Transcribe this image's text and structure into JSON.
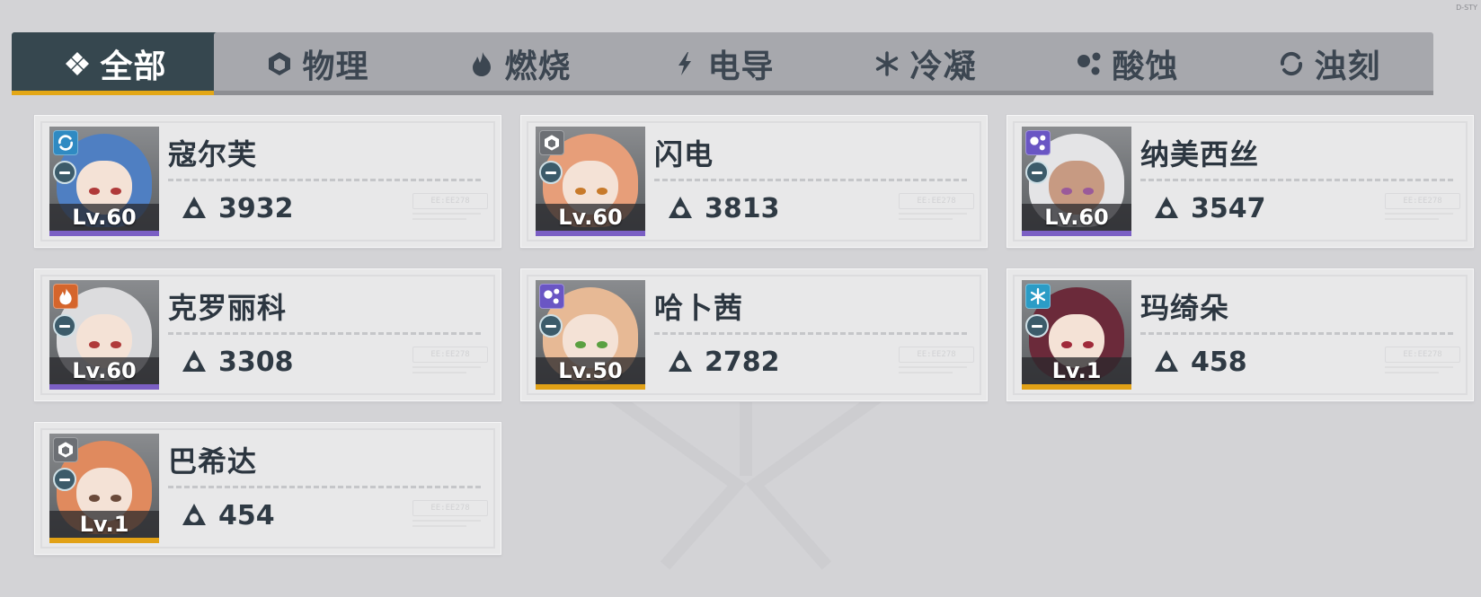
{
  "corner_code": "D-STY",
  "tabs": [
    {
      "label": "全部",
      "icon": "diamond-cluster-icon",
      "active": true
    },
    {
      "label": "物理",
      "icon": "hexagon-icon",
      "active": false
    },
    {
      "label": "燃烧",
      "icon": "flame-icon",
      "active": false
    },
    {
      "label": "电导",
      "icon": "lightning-icon",
      "active": false
    },
    {
      "label": "冷凝",
      "icon": "snowflake-icon",
      "active": false
    },
    {
      "label": "酸蚀",
      "icon": "acid-dots-icon",
      "active": false
    },
    {
      "label": "浊刻",
      "icon": "swirl-icon",
      "active": false
    }
  ],
  "colors": {
    "active_tab_bg": "#36474f",
    "active_tab_underline": "#e3a716",
    "rarity_purple": "#7b5fc4",
    "rarity_gold": "#e1a116",
    "elem_physical": "#6c6f74",
    "elem_burn": "#d5652c",
    "elem_electric": "#5b6fb5",
    "elem_freeze": "#2b9cc6",
    "elem_acid": "#6a56c4",
    "elem_turbid": "#2f8ac2"
  },
  "characters": [
    {
      "name": "寇尔芙",
      "level": "Lv.60",
      "power": "3932",
      "element": "swirl-icon",
      "rarity": "purple"
    },
    {
      "name": "闪电",
      "level": "Lv.60",
      "power": "3813",
      "element": "hexagon-icon",
      "rarity": "purple"
    },
    {
      "name": "纳美西丝",
      "level": "Lv.60",
      "power": "3547",
      "element": "acid-dots-icon",
      "rarity": "purple"
    },
    {
      "name": "克罗丽科",
      "level": "Lv.60",
      "power": "3308",
      "element": "flame-icon",
      "rarity": "purple"
    },
    {
      "name": "哈卜茜",
      "level": "Lv.50",
      "power": "2782",
      "element": "acid-dots-icon",
      "rarity": "gold"
    },
    {
      "name": "玛绮朵",
      "level": "Lv.1",
      "power": "458",
      "element": "snowflake-icon",
      "rarity": "gold"
    },
    {
      "name": "巴希达",
      "level": "Lv.1",
      "power": "454",
      "element": "hexagon-icon",
      "rarity": "gold"
    }
  ]
}
